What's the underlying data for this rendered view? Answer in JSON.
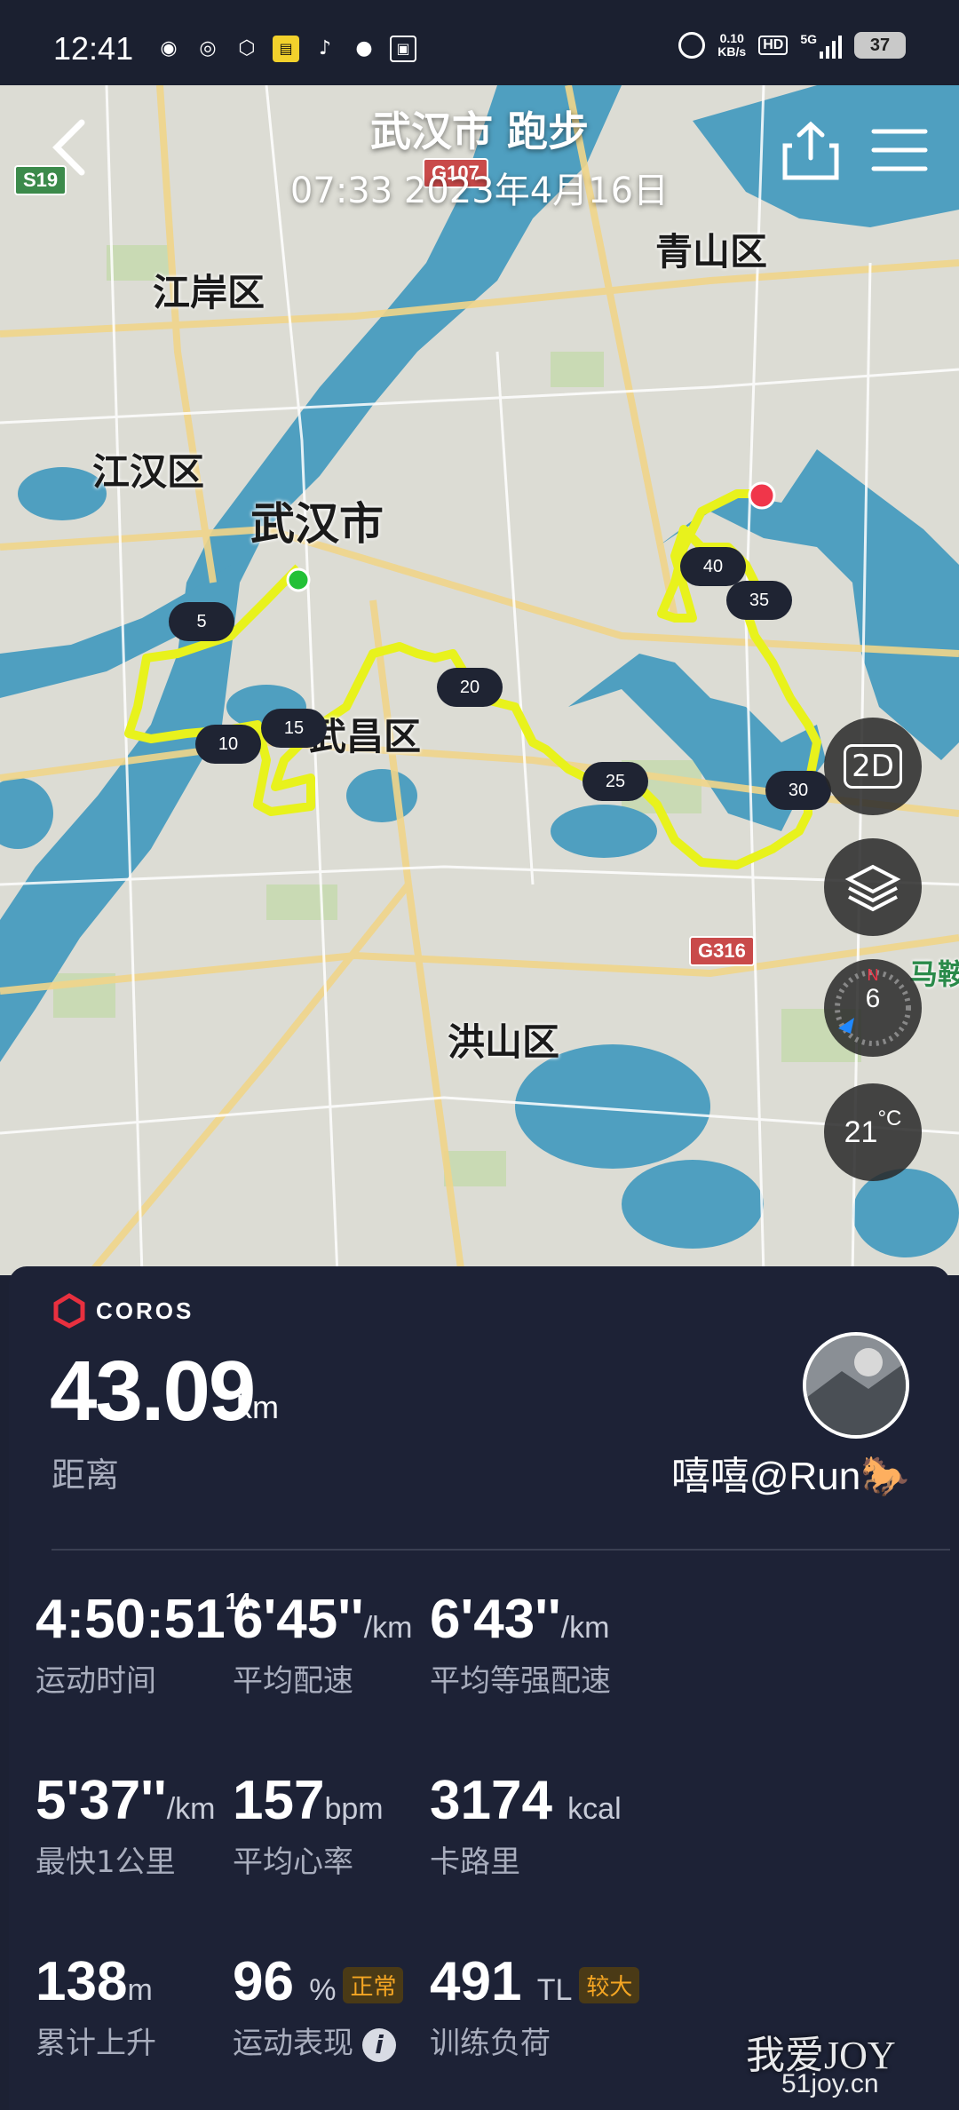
{
  "status_bar": {
    "time": "12:41",
    "net_speed_value": "0.10",
    "net_speed_unit": "KB/s",
    "hd": "HD",
    "network": "5G",
    "battery": "37"
  },
  "header": {
    "title": "武汉市 跑步",
    "subtitle": "07:33 2023年4月16日"
  },
  "map": {
    "labels": {
      "jiangan": "江岸区",
      "jianghan": "江汉区",
      "wuhan": "武汉市",
      "qingshan": "青山区",
      "wuchang": "武昌区",
      "hongshan": "洪山区",
      "maan": "马鞍"
    },
    "road_shields": {
      "s19": "S19",
      "g107": "G107",
      "g316": "G316"
    },
    "km_markers": [
      "5",
      "10",
      "15",
      "20",
      "25",
      "30",
      "35",
      "40"
    ],
    "controls": {
      "view_mode": "2D",
      "compass_value": "6",
      "compass_north": "N",
      "temperature": "21",
      "temperature_unit": "°C"
    }
  },
  "stats": {
    "brand": "COROS",
    "distance": "43.09",
    "distance_unit": "km",
    "distance_label": "距离",
    "username": "嘻嘻@Run🐎",
    "metrics": {
      "duration": {
        "value": "4:50:51",
        "sup": "14",
        "label": "运动时间"
      },
      "avg_pace": {
        "value": "6'45''",
        "unit": "/km",
        "label": "平均配速"
      },
      "avg_grade_pace": {
        "value": "6'43''",
        "unit": "/km",
        "label": "平均等强配速"
      },
      "fastest_km": {
        "value": "5'37''",
        "unit": "/km",
        "label": "最快1公里"
      },
      "avg_hr": {
        "value": "157",
        "unit": "bpm",
        "label": "平均心率"
      },
      "calories": {
        "value": "3174",
        "unit": "kcal",
        "label": "卡路里"
      },
      "elevation": {
        "value": "138",
        "unit": "m",
        "label": "累计上升"
      },
      "performance": {
        "value": "96",
        "unit": "%",
        "tag": "正常",
        "label": "运动表现"
      },
      "training_load": {
        "value": "491",
        "unit": "TL",
        "tag": "较大",
        "label": "训练负荷"
      }
    }
  },
  "watermark": {
    "main": "我爱JOY",
    "sub": "51joy.cn"
  },
  "colors": {
    "route": "#e8f21c",
    "water": "#4f9fc0",
    "panel": "#1d2236",
    "start": "#22c036",
    "end": "#f0364a"
  }
}
